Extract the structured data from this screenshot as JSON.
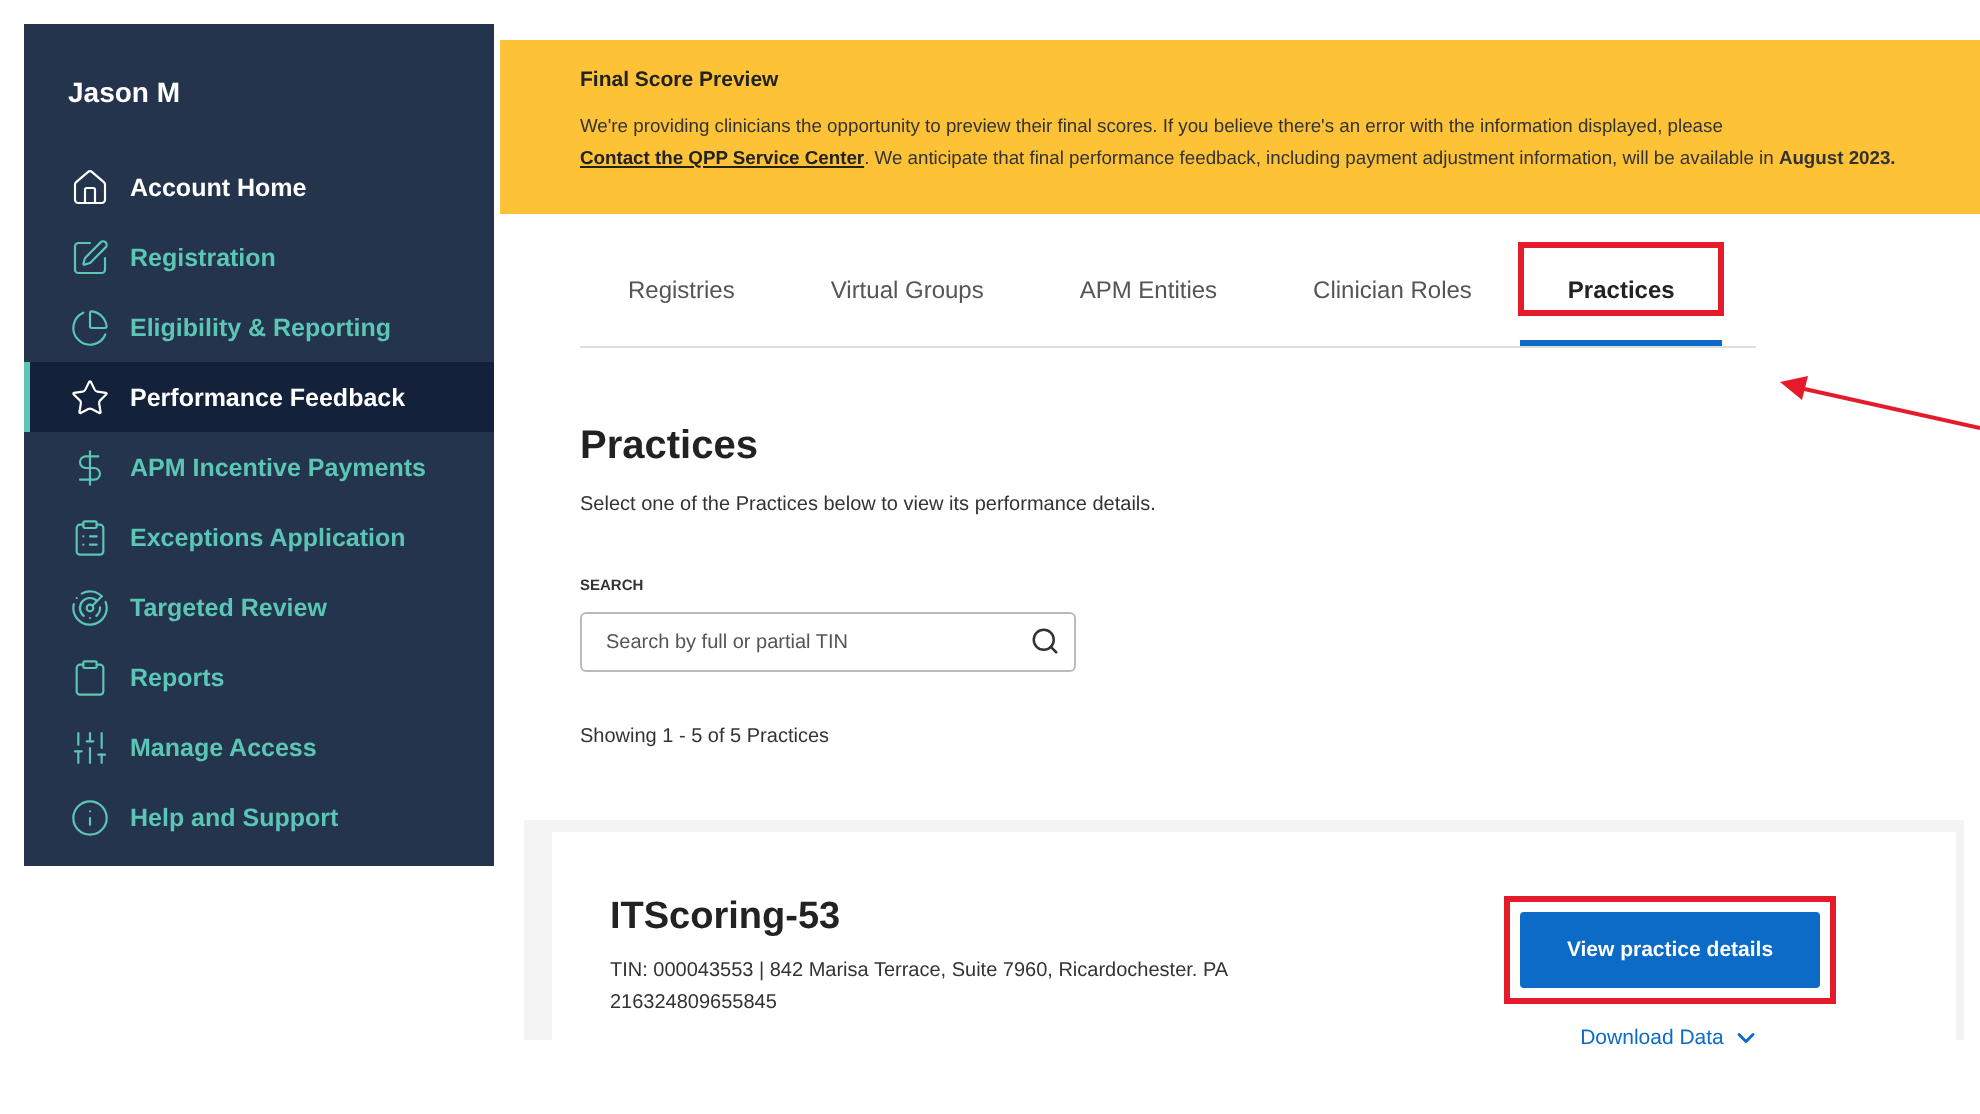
{
  "sidebar": {
    "user": "Jason M",
    "items": [
      {
        "label": "Account Home",
        "kind": "home",
        "selected": false
      },
      {
        "label": "Registration",
        "kind": "link",
        "selected": false
      },
      {
        "label": "Eligibility & Reporting",
        "kind": "link",
        "selected": false
      },
      {
        "label": "Performance Feedback",
        "kind": "link",
        "selected": true
      },
      {
        "label": "APM Incentive Payments",
        "kind": "link",
        "selected": false
      },
      {
        "label": "Exceptions Application",
        "kind": "link",
        "selected": false
      },
      {
        "label": "Targeted Review",
        "kind": "link",
        "selected": false
      },
      {
        "label": "Reports",
        "kind": "link",
        "selected": false
      },
      {
        "label": "Manage Access",
        "kind": "link",
        "selected": false
      },
      {
        "label": "Help and Support",
        "kind": "link",
        "selected": false
      }
    ]
  },
  "banner": {
    "title": "Final Score Preview",
    "text_before": "We're providing clinicians the opportunity to preview their final scores. If you believe there's an error with the information displayed, please",
    "link": "Contact the QPP Service Center",
    "text_after": ". We anticipate that final performance feedback, including payment adjustment information, will be available in **August 2023.**"
  },
  "tabs": [
    {
      "label": "Registries",
      "selected": false,
      "highlighted": false
    },
    {
      "label": "Virtual Groups",
      "selected": false,
      "highlighted": false
    },
    {
      "label": "APM Entities",
      "selected": false,
      "highlighted": false
    },
    {
      "label": "Clinician Roles",
      "selected": false,
      "highlighted": false
    },
    {
      "label": "Practices",
      "selected": true,
      "highlighted": true
    }
  ],
  "heading": "Practices",
  "description": "Select one of the Practices below to view its performance details.",
  "search": {
    "label": "SEARCH",
    "placeholder": "Search by full or partial TIN"
  },
  "count": "Showing 1 - 5 of 5 Practices",
  "practices": [
    {
      "name": "ITScoring-53",
      "details": "TIN: 000043553 | 842 Marisa Terrace, Suite 7960, Ricardochester. PA 216324809655845",
      "button": "View practice details",
      "button_highlighted": true,
      "download": "Download Data"
    }
  ]
}
